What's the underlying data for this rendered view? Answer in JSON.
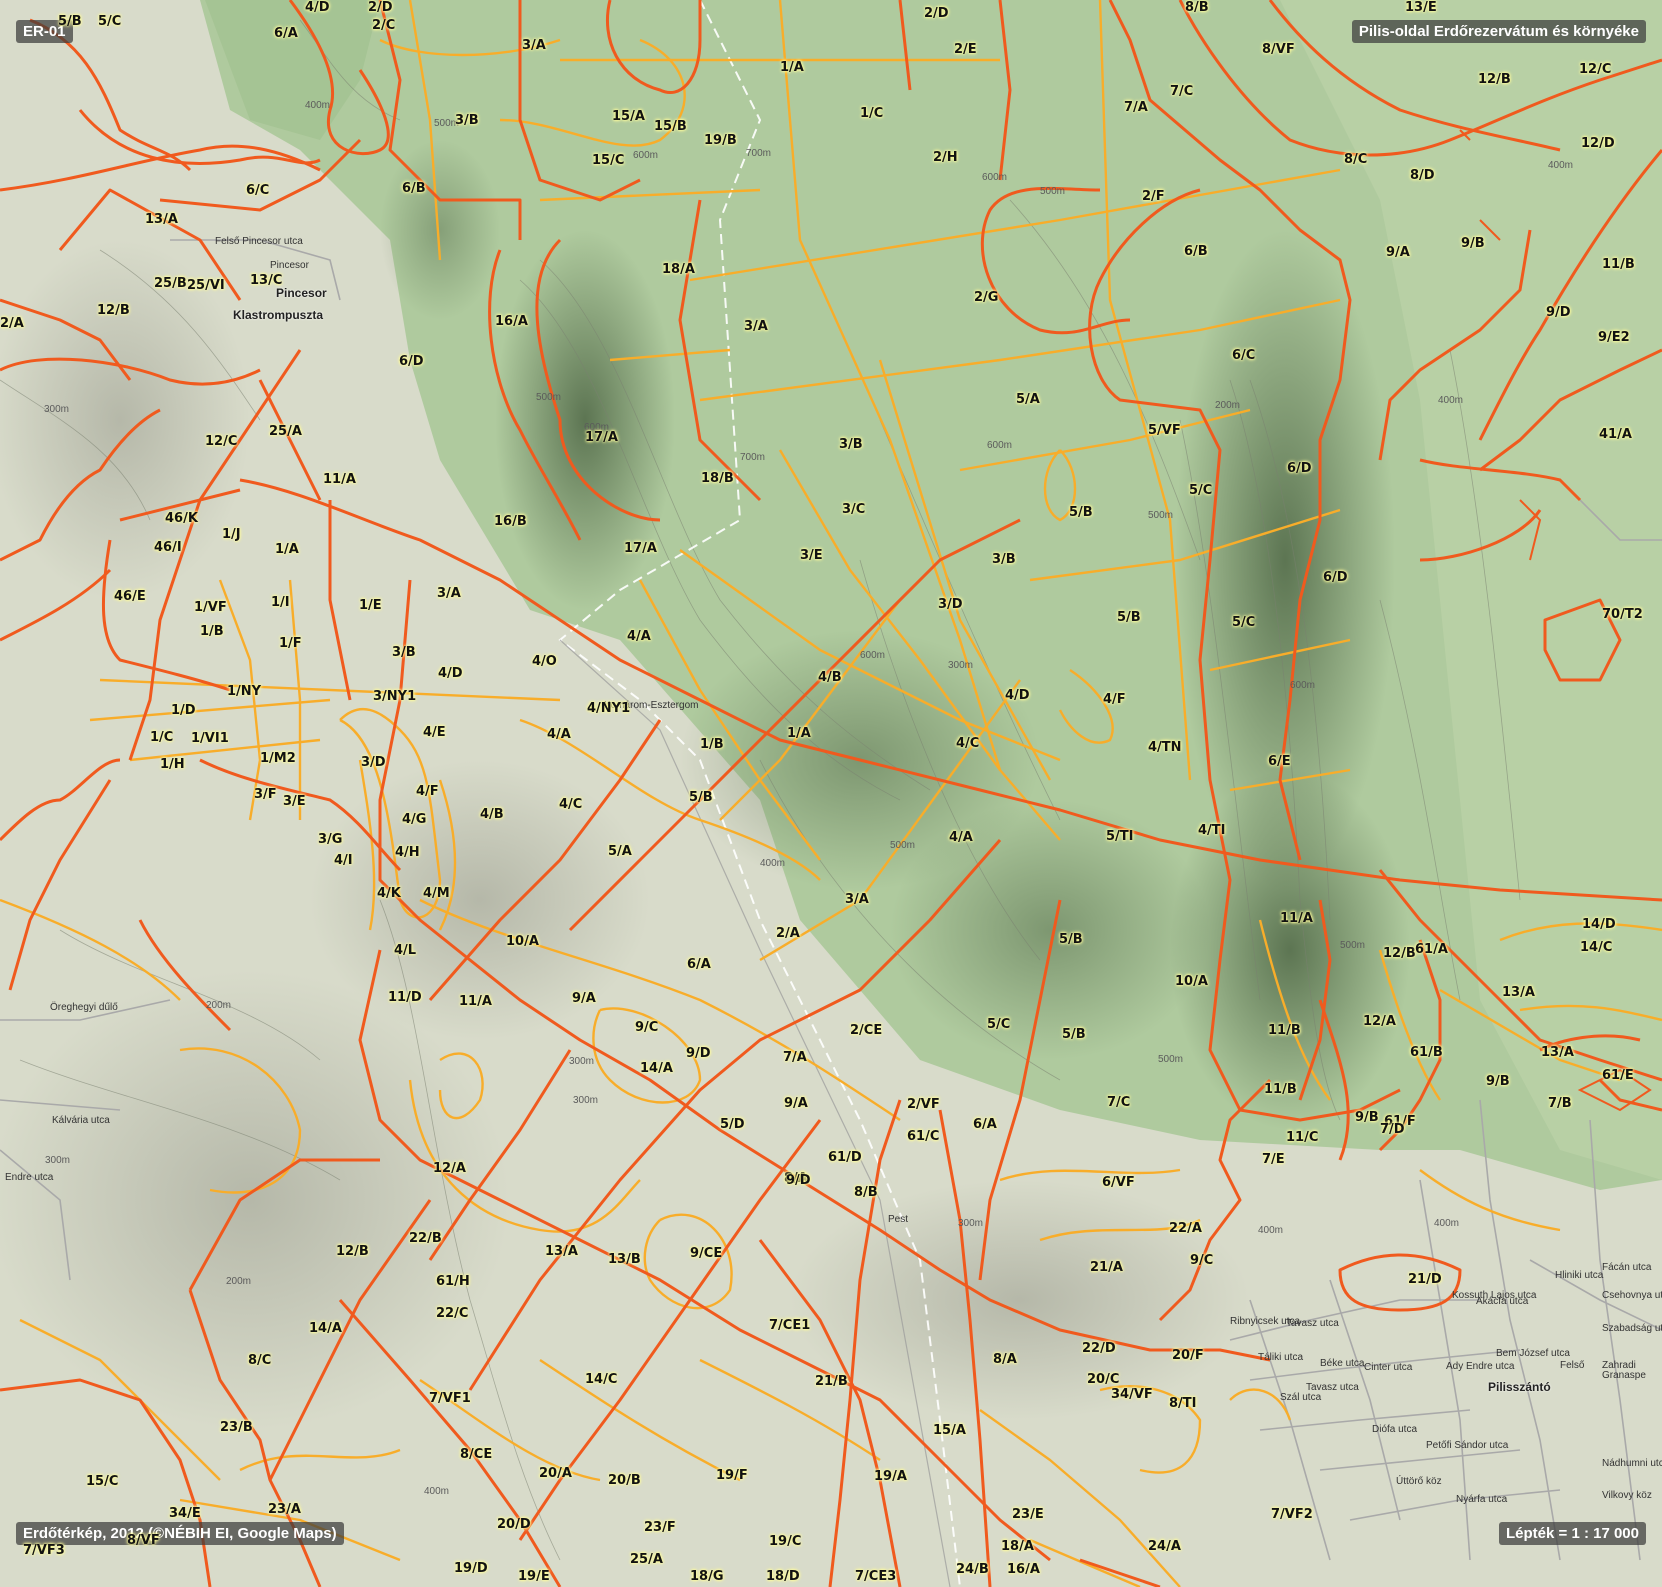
{
  "overlay": {
    "map_id": "ER-01",
    "title": "Pilis-oldal Erdőrezervátum és környéke",
    "credit": "Erdőtérkép, 2012 (©NÉBIH EI, Google Maps)",
    "scale": "Lépték = 1 : 17 000"
  },
  "colors": {
    "red_boundary": "#f05a1e",
    "orange_boundary": "#f8ad2a",
    "forest_green": "#a8c796",
    "dark_ridge": "#5f7a56",
    "label_halo": "#ffff9a"
  },
  "places": [
    "Klastrompuszta",
    "Pincesor",
    "Pilisszántó"
  ],
  "streets": [
    "Felső Pincesor utca",
    "Pincesor",
    "Komárom-Esztergom",
    "Pest",
    "Öreghegyi dűlő",
    "Kálvária utca",
    "Endre utca",
    "Ribnyicsek utca",
    "Tavasz utca",
    "Táliki utca",
    "Béke utca",
    "Szál utca",
    "Tavasz utca",
    "Cinter utca",
    "Ady Endre utca",
    "Bem József utca",
    "Akácfa utca",
    "Kossuth Lajos utca",
    "Hliniki utca",
    "Fácán utca",
    "Csehovnya utca",
    "Szabadság utca",
    "Diófa utca",
    "Petőfi Sándor utca",
    "Úttörő köz",
    "Nyárfa utca",
    "Zahradi",
    "Granaspe",
    "Nádhumni utca",
    "Vilkovy köz",
    "Felső"
  ],
  "contours": [
    "400m",
    "500m",
    "600m",
    "700m",
    "600m",
    "500m",
    "400m",
    "300m",
    "200m",
    "300m",
    "400m",
    "500m",
    "600m",
    "700m",
    "600m",
    "500m",
    "400m",
    "300m",
    "200m",
    "300m",
    "400m",
    "500m",
    "600m",
    "300m",
    "200m",
    "400m",
    "300m",
    "400m",
    "500m",
    "600m",
    "500m"
  ],
  "compartments": [
    "5/B",
    "5/C",
    "4/D",
    "2/D",
    "3/A",
    "6/A",
    "2/C",
    "2/D",
    "1/A",
    "2/E",
    "8/B",
    "13/E",
    "8/VF",
    "7/A",
    "7/C",
    "12/B",
    "12/C",
    "12/D",
    "3/B",
    "15/A",
    "15/B",
    "19/B",
    "1/C",
    "2/H",
    "15/C",
    "8/C",
    "8/D",
    "6/C",
    "6/B",
    "2/F",
    "13/A",
    "25/B",
    "25/VI",
    "13/C",
    "6/B",
    "18/A",
    "9/A",
    "9/B",
    "11/B",
    "12/B",
    "2/A",
    "2/G",
    "3/A",
    "16/A",
    "6/D",
    "9/D",
    "9/E2",
    "6/C",
    "5/A",
    "12/C",
    "25/A",
    "17/A",
    "3/B",
    "5/VF",
    "41/A",
    "11/A",
    "18/B",
    "6/D",
    "5/C",
    "46/K",
    "3/C",
    "5/B",
    "46/I",
    "1/J",
    "1/A",
    "16/B",
    "17/A",
    "3/E",
    "3/B",
    "6/D",
    "3/D",
    "46/E",
    "1/VF",
    "1/I",
    "1/E",
    "3/A",
    "5/B",
    "5/C",
    "1/B",
    "1/F",
    "3/B",
    "4/A",
    "4/O",
    "4/D",
    "4/B",
    "70/T2",
    "4/D",
    "4/F",
    "1/D",
    "1/NY",
    "3/NY1",
    "4/NY1",
    "1/C",
    "1/VI1",
    "4/E",
    "4/A",
    "1/A",
    "1/B",
    "4/C",
    "4/TN",
    "1/H",
    "1/M2",
    "3/D",
    "6/E",
    "4/F",
    "3/F",
    "3/E",
    "4/G",
    "4/B",
    "4/C",
    "5/B",
    "4/A",
    "5/TI",
    "4/TI",
    "3/G",
    "4/H",
    "5/A",
    "4/I",
    "3/A",
    "4/K",
    "4/M",
    "11/A",
    "14/D",
    "14/C",
    "10/A",
    "2/A",
    "5/B",
    "12/B",
    "61/A",
    "4/L",
    "6/A",
    "10/A",
    "11/D",
    "11/A",
    "9/A",
    "13/A",
    "9/C",
    "2/CE",
    "5/C",
    "5/B",
    "11/B",
    "12/A",
    "9/D",
    "7/A",
    "61/B",
    "13/A",
    "14/A",
    "9/B",
    "61/E",
    "11/B",
    "2/VF",
    "7/B",
    "9/A",
    "7/C",
    "5/D",
    "6/A",
    "61/C",
    "61/F",
    "11/C",
    "7/D",
    "12/A",
    "61/D",
    "7/E",
    "9/B",
    "8/A",
    "6/VF",
    "8/B",
    "9/D",
    "22/A",
    "22/B",
    "12/B",
    "13/A",
    "13/B",
    "9/CE",
    "9/C",
    "21/A",
    "61/H",
    "21/D",
    "22/C",
    "14/A",
    "7/CE1",
    "8/A",
    "22/D",
    "8/C",
    "20/F",
    "14/C",
    "21/B",
    "20/C",
    "7/VF1",
    "8/TI",
    "23/B",
    "34/VF",
    "15/A",
    "8/CE",
    "20/A",
    "20/B",
    "19/F",
    "19/A",
    "15/C",
    "34/E",
    "23/E",
    "23/A",
    "20/D",
    "7/VF2",
    "8/VF",
    "23/F",
    "19/C",
    "18/A",
    "24/A",
    "7/VF3",
    "25/A",
    "19/D",
    "24/B",
    "16/A",
    "7/CE3",
    "18/D",
    "18/G",
    "19/E",
    "22/D",
    "4/C"
  ]
}
